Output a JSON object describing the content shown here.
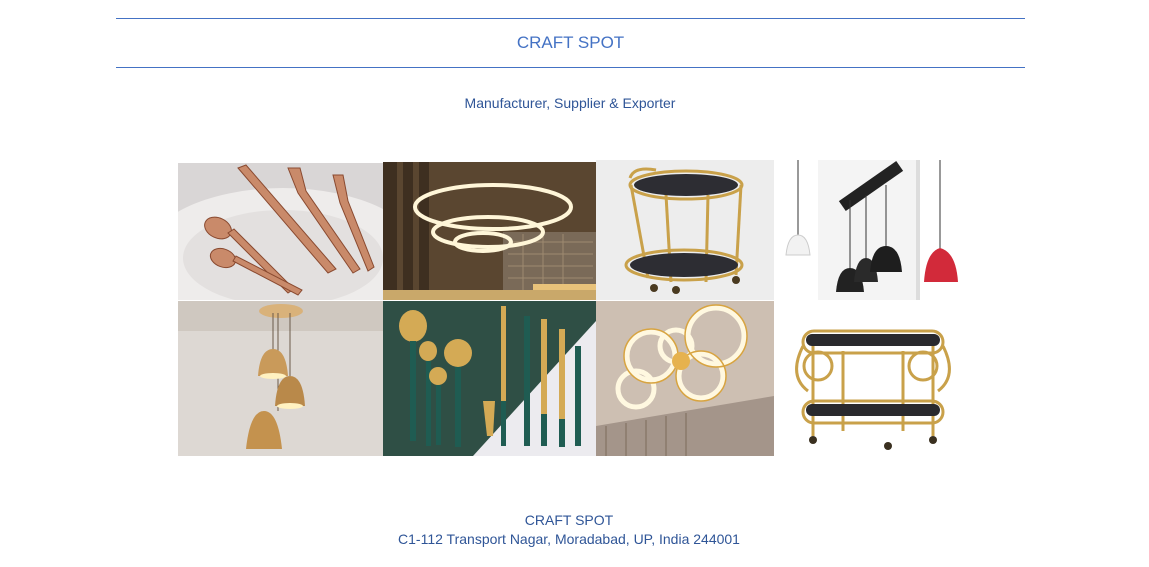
{
  "header": {
    "company_name": "CRAFT SPOT",
    "tagline": "Manufacturer, Supplier & Exporter"
  },
  "gallery": [
    {
      "name": "rose-gold-cutlery-photo",
      "subject": "Rose gold cutlery set"
    },
    {
      "name": "ring-chandelier-photo",
      "subject": "LED ring chandelier"
    },
    {
      "name": "gold-bar-cart-photo",
      "subject": "Round gold bar cart"
    },
    {
      "name": "pendant-lamps-photo",
      "subject": "Pendant lamps"
    },
    {
      "name": "wooden-pendant-lamps-photo",
      "subject": "Wooden pendant lamps"
    },
    {
      "name": "gold-green-cutlery-photo",
      "subject": "Gold and green cutlery"
    },
    {
      "name": "ring-ceiling-light-photo",
      "subject": "LED ring ceiling light"
    },
    {
      "name": "oval-gold-trolley-photo",
      "subject": "Oval gold serving trolley"
    }
  ],
  "footer": {
    "company_name": "CRAFT SPOT",
    "address": "C1-112 Transport Nagar, Moradabad, UP, India 244001"
  },
  "colors": {
    "accent": "#4472c4",
    "text": "#2f5597",
    "gold": "#c9a14a"
  }
}
